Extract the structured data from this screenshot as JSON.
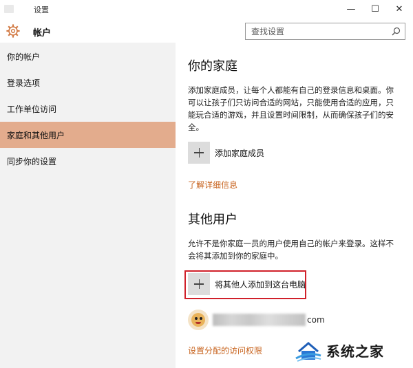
{
  "window": {
    "title": "设置",
    "controls": {
      "minimize": "—",
      "maximize": "☐",
      "close": "✕"
    }
  },
  "header": {
    "title": "帐户",
    "icon": "gear-icon",
    "search": {
      "placeholder": "查找设置",
      "value": ""
    }
  },
  "sidebar": {
    "items": [
      {
        "label": "你的帐户",
        "active": false
      },
      {
        "label": "登录选项",
        "active": false
      },
      {
        "label": "工作单位访问",
        "active": false
      },
      {
        "label": "家庭和其他用户",
        "active": true
      },
      {
        "label": "同步你的设置",
        "active": false
      }
    ]
  },
  "family": {
    "heading": "你的家庭",
    "description": "添加家庭成员，让每个人都能有自己的登录信息和桌面。你可以让孩子们只访问合适的网站，只能使用合适的应用，只能玩合适的游戏，并且设置时间限制，从而确保孩子们的安全。",
    "add_label": "添加家庭成员",
    "learn_more": "了解详细信息"
  },
  "others": {
    "heading": "其他用户",
    "description": "允许不是你家庭一员的用户使用自己的帐户来登录。这样不会将其添加到你的家庭中。",
    "add_label": "将其他人添加到这台电脑",
    "user_email_suffix": "com",
    "assigned_access": "设置分配的访问权限"
  },
  "watermark": {
    "text": "系统之家"
  },
  "colors": {
    "accent_active": "#e3ac8d",
    "link": "#c8641f",
    "highlight": "#d0202a",
    "sidebar_bg": "#f2f2f2"
  }
}
